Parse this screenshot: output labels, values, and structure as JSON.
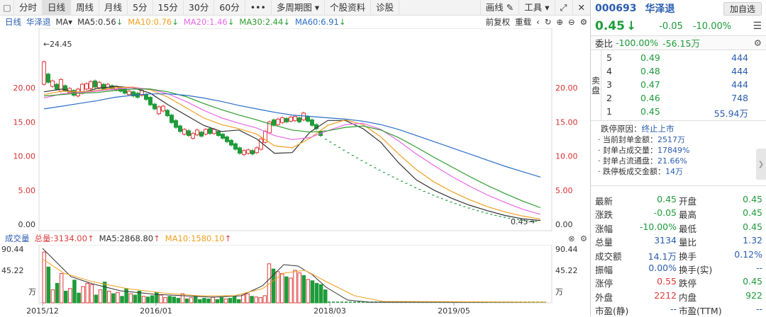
{
  "toolbar": {
    "tabs": [
      "分时",
      "日线",
      "周线",
      "月线",
      "5分",
      "15分",
      "30分",
      "60分",
      "•••",
      "多周期图 ▾",
      "个股资料",
      "诊股"
    ],
    "active_tab": "日线",
    "right": [
      "画线",
      "工具",
      "⤢",
      "✕"
    ]
  },
  "status": {
    "period": "日线",
    "stock": "华泽退",
    "ma_label": "MA▾",
    "ma5": "MA5:0.56",
    "ma10": "MA10:0.76",
    "ma20": "MA20:1.46",
    "ma30": "MA30:2.44",
    "ma60": "MA60:6.91",
    "fq": "前复权",
    "reload": "重载"
  },
  "vol_status": {
    "label": "成交量",
    "total": "总量:3134.00",
    "ma5": "MA5:2868.80",
    "ma10": "MA10:1580.10"
  },
  "colors": {
    "up": "#e03b3b",
    "down": "#1e9c3a",
    "ma5": "#333333",
    "ma10": "#f0a020",
    "ma20": "#e868e8",
    "ma30": "#2c9c2c",
    "ma60": "#2a6fc8",
    "axis_red": "#d83030"
  },
  "chart_data": {
    "type": "line",
    "x_ticks": [
      "2015/12",
      "2016/01",
      "2018/03",
      "2019/05"
    ],
    "y_ticks": [
      "20.00",
      "15.00",
      "10.00",
      "5.00",
      "0.00"
    ],
    "ylim": [
      0,
      25
    ],
    "annotations": [
      "24.45",
      "0.45"
    ],
    "volume_ticks": [
      "90.44",
      "45.22",
      "万"
    ],
    "series": [
      {
        "name": "MA5",
        "values": [
          19.4,
          19.8,
          19.2,
          19.9,
          20.2,
          20.0,
          19.2,
          17.5,
          16.0,
          14.5,
          13.6,
          13.8,
          12.5,
          10.4,
          10.5,
          13.5,
          15.2,
          15.2,
          14.0,
          12.0,
          9.0,
          6.5,
          5.0,
          3.8,
          2.8,
          2.0,
          1.3,
          0.8,
          0.56
        ]
      },
      {
        "name": "MA10",
        "values": [
          19.0,
          19.5,
          19.4,
          19.6,
          20.0,
          20.1,
          19.7,
          18.6,
          17.1,
          15.6,
          14.6,
          14.0,
          13.2,
          11.5,
          11.2,
          12.6,
          14.5,
          15.3,
          14.6,
          12.8,
          10.3,
          8.0,
          6.2,
          4.8,
          3.6,
          2.6,
          1.8,
          1.2,
          0.76
        ]
      },
      {
        "name": "MA20",
        "values": [
          18.5,
          19.1,
          19.3,
          19.5,
          19.8,
          20.0,
          19.8,
          19.1,
          18.0,
          16.7,
          15.6,
          14.8,
          14.1,
          13.0,
          12.4,
          12.7,
          13.7,
          14.6,
          14.8,
          13.9,
          12.2,
          10.3,
          8.6,
          7.0,
          5.6,
          4.3,
          3.2,
          2.2,
          1.46
        ]
      },
      {
        "name": "MA30",
        "values": [
          18.8,
          19.0,
          19.2,
          19.3,
          19.6,
          19.8,
          19.8,
          19.4,
          18.7,
          17.7,
          16.8,
          16.0,
          15.3,
          14.5,
          13.8,
          13.5,
          13.7,
          14.2,
          14.4,
          13.8,
          12.7,
          11.3,
          9.8,
          8.4,
          7.0,
          5.7,
          4.5,
          3.4,
          2.44
        ]
      },
      {
        "name": "MA60",
        "values": [
          16.9,
          17.3,
          17.7,
          18.1,
          18.6,
          18.9,
          19.1,
          19.1,
          18.9,
          18.5,
          18.0,
          17.4,
          16.9,
          16.4,
          16.0,
          15.8,
          15.6,
          15.4,
          15.1,
          14.6,
          13.9,
          13.0,
          12.1,
          11.2,
          10.3,
          9.4,
          8.5,
          7.7,
          6.91
        ]
      }
    ]
  },
  "panel": {
    "code": "000693",
    "name": "华泽退",
    "add_btn": "加自选",
    "price": "0.45",
    "price_arrow": "↓",
    "change": "-0.05",
    "change_pct": "-10.00%",
    "wb_label": "委比",
    "wb_pct": "-100.00%",
    "wb_val": "-56.15万",
    "sell_tag": [
      "卖",
      "盘"
    ],
    "sell": [
      {
        "lvl": "5",
        "p": "0.49",
        "v": "444"
      },
      {
        "lvl": "4",
        "p": "0.48",
        "v": "444"
      },
      {
        "lvl": "3",
        "p": "0.47",
        "v": "444"
      },
      {
        "lvl": "2",
        "p": "0.46",
        "v": "748"
      },
      {
        "lvl": "1",
        "p": "0.45",
        "v": "55.94万"
      }
    ],
    "reason_label": "跌停原因：",
    "reason_val": "终止上市",
    "reason_lines": [
      {
        "k": "· 当前封单金额：",
        "v": "2517万"
      },
      {
        "k": "· 封单占成交量：",
        "v": "17849%"
      },
      {
        "k": "· 封单占流通盘：",
        "v": "21.66%"
      },
      {
        "k": "· 跌停板成交金额：",
        "v": "14万"
      }
    ],
    "quote": [
      {
        "l1": "最新",
        "v1": "0.45",
        "c1": "green",
        "l2": "开盘",
        "v2": "0.45",
        "c2": "green"
      },
      {
        "l1": "涨跌",
        "v1": "-0.05",
        "c1": "green",
        "l2": "最高",
        "v2": "0.45",
        "c2": "green"
      },
      {
        "l1": "涨幅",
        "v1": "-10.00%",
        "c1": "green",
        "l2": "最低",
        "v2": "0.45",
        "c2": "green"
      },
      {
        "l1": "总量",
        "v1": "3134",
        "c1": "blue",
        "l2": "量比",
        "v2": "1.32",
        "c2": "blue"
      },
      {
        "l1": "成交额",
        "v1": "14.1万",
        "c1": "blue",
        "l2": "换手",
        "v2": "0.12%",
        "c2": "blue"
      },
      {
        "l1": "振幅",
        "v1": "0.00%",
        "c1": "blue",
        "l2": "换手(实)",
        "v2": "--",
        "c2": "blue"
      },
      {
        "l1": "涨停",
        "v1": "0.55",
        "c1": "red",
        "l2": "跌停",
        "v2": "0.45",
        "c2": "green"
      },
      {
        "l1": "外盘",
        "v1": "2212",
        "c1": "red",
        "l2": "内盘",
        "v2": "922",
        "c2": "green"
      },
      {
        "l1": "市盈(静)",
        "v1": "--",
        "c1": "blue",
        "l2": "市盈(TTM)",
        "v2": "--",
        "c2": "blue"
      }
    ]
  }
}
